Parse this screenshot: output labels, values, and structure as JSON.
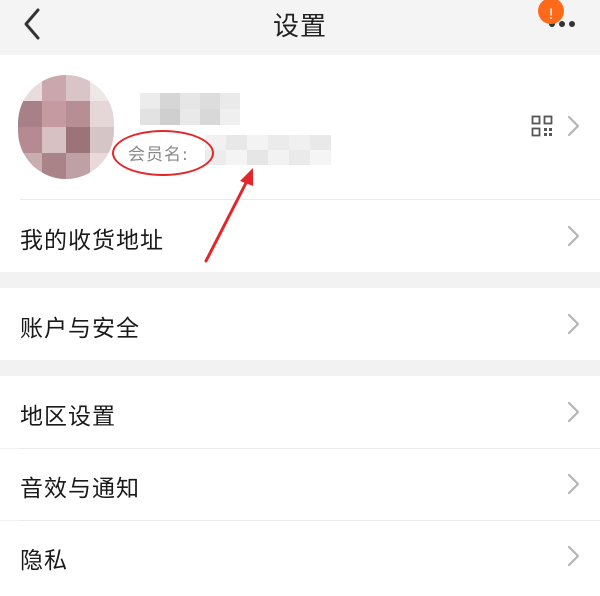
{
  "header": {
    "title": "设置",
    "badge_count": "!",
    "back_icon": "chevron-left-icon",
    "more_icon": "more-dots-icon"
  },
  "profile": {
    "member_label": "会员名:",
    "qr_icon": "qr-code-icon",
    "chevron_icon": "chevron-right-icon"
  },
  "menu": {
    "address": "我的收货地址",
    "account_security": "账户与安全",
    "region": "地区设置",
    "sound_notify": "音效与通知",
    "privacy": "隐私"
  },
  "colors": {
    "badge": "#ff6a1a",
    "annotation": "#e3262a",
    "chevron": "#b5b5b5",
    "section_gap": "#f2f2f2"
  }
}
